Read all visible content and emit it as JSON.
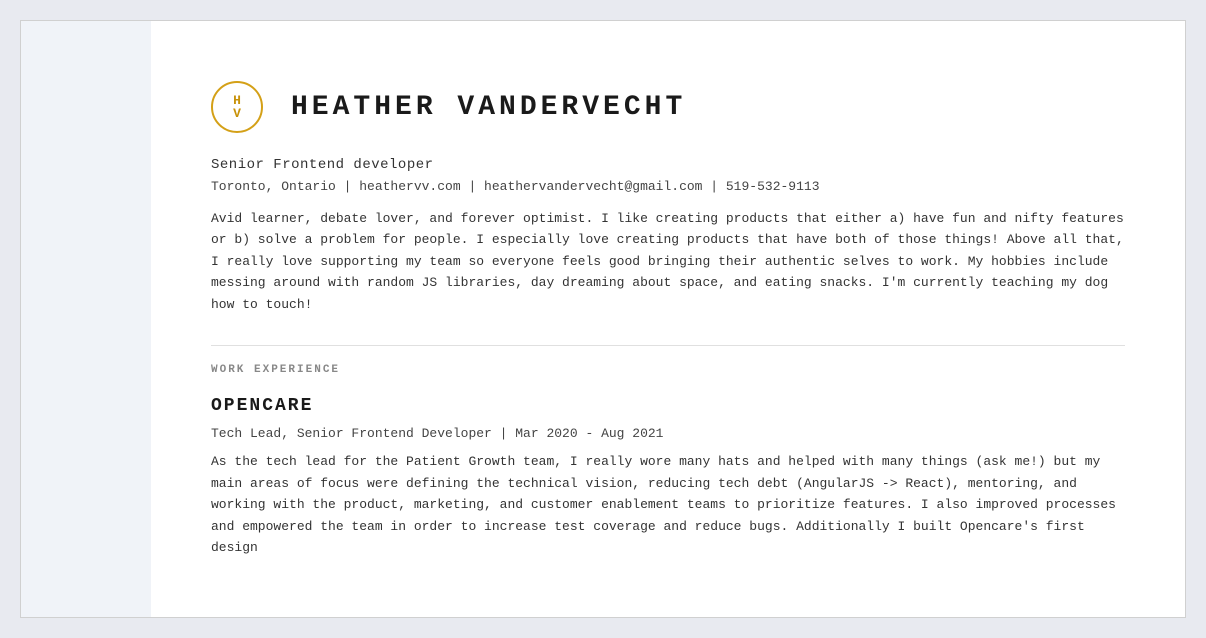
{
  "page": {
    "background_color": "#e8eaf0",
    "sidebar_color": "#f0f3f8"
  },
  "profile": {
    "avatar": {
      "letter_top": "H",
      "letter_bottom": "V",
      "border_color": "#d4a017"
    },
    "full_name": "HEATHER  VANDERVECHT",
    "job_title": "Senior Frontend developer",
    "contact": "Toronto, Ontario | heathervv.com | heathervandervecht@gmail.com | 519-532-9113",
    "bio": "Avid learner, debate lover, and forever optimist. I like creating products that either a) have fun and nifty features or b) solve a problem for people. I especially love creating products that have both of those things! Above all that, I really love supporting my team so everyone feels good bringing their authentic selves to work. My hobbies include messing around with random JS libraries, day dreaming about space, and eating snacks. I'm currently teaching my dog how to touch!"
  },
  "sections": {
    "work_experience": {
      "label": "WORK EXPERIENCE",
      "companies": [
        {
          "name": "OPENCARE",
          "position": "Tech Lead, Senior Frontend Developer | Mar 2020 - Aug 2021",
          "description": "As the tech lead for the Patient Growth team, I really wore many hats and helped with many things (ask me!) but my main areas of focus were defining the technical vision, reducing tech debt (AngularJS -> React), mentoring, and working with the product, marketing, and customer enablement teams to prioritize features. I also improved processes and empowered the team in order to increase test coverage and reduce bugs. Additionally I built Opencare's first design"
        }
      ]
    }
  }
}
